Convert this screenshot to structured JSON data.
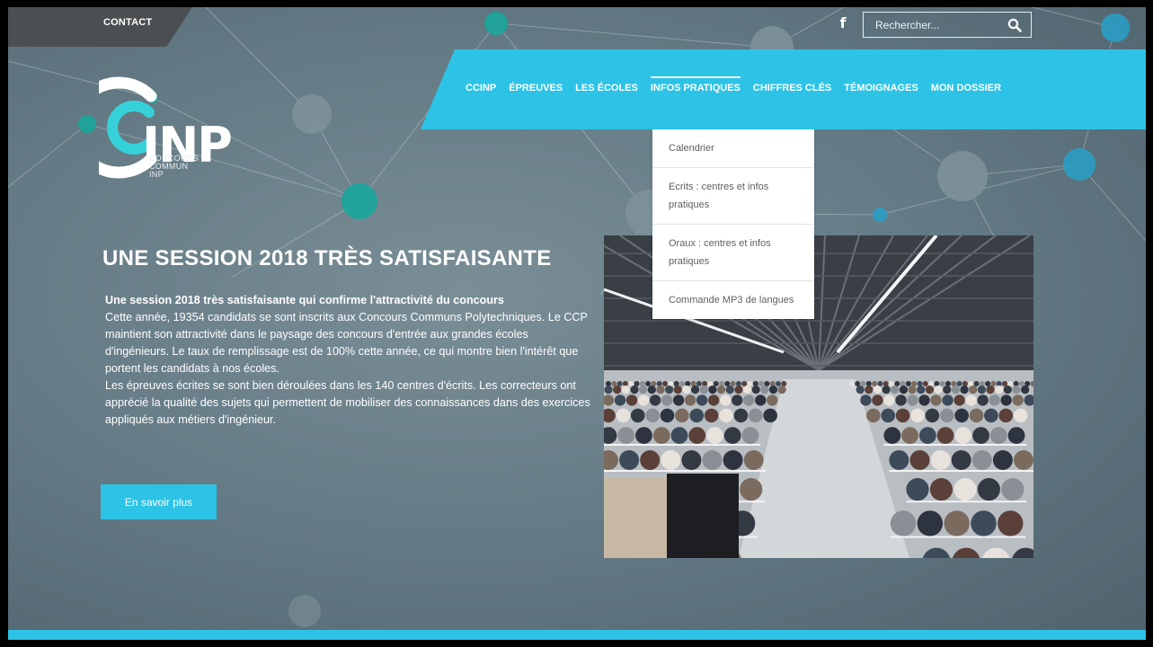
{
  "top_bar": {
    "contact_label": "CONTACT",
    "facebook_icon": "facebook-icon",
    "search_placeholder": "Rechercher...",
    "search_icon": "search-icon"
  },
  "logo": {
    "mark_text": "INP",
    "subtitle_lines": [
      "CONCOURS",
      "COMMUN",
      "INP"
    ]
  },
  "nav": {
    "items": [
      {
        "label": "CCINP",
        "active": false
      },
      {
        "label": "ÉPREUVES",
        "active": false
      },
      {
        "label": "LES ÉCOLES",
        "active": false
      },
      {
        "label": "INFOS PRATIQUES",
        "active": true
      },
      {
        "label": "CHIFFRES CLÉS",
        "active": false
      },
      {
        "label": "TÉMOIGNAGES",
        "active": false
      },
      {
        "label": "MON DOSSIER",
        "active": false
      }
    ]
  },
  "dropdown": {
    "items": [
      {
        "label": "Calendrier"
      },
      {
        "label": "Ecrits : centres et infos pratiques"
      },
      {
        "label": "Oraux : centres et infos pratiques"
      },
      {
        "label": "Commande MP3 de langues"
      }
    ]
  },
  "hero": {
    "title": "UNE SESSION 2018 TRÈS SATISFAISANTE",
    "lead": "Une session 2018 très satisfaisante qui confirme l'attractivité du concours",
    "paragraph_1": "Cette année, 19354 candidats se sont inscrits aux Concours Communs Polytechniques. Le CCP maintient son attractivité dans le paysage des concours d'entrée aux grandes écoles d'ingénieurs. Le taux de remplissage est de 100% cette année, ce qui montre bien l'intérêt que portent les candidats à nos écoles.",
    "paragraph_2": "Les épreuves écrites se sont bien déroulées dans les 140 centres d'écrits. Les correcteurs ont apprécié la qualité des sujets qui permettent de mobiliser des connaissances dans des exercices appliqués aux métiers d'ingénieur.",
    "button_label": "En savoir plus"
  },
  "colors": {
    "accent": "#2cc3e6",
    "node_teal": "#1aa69a",
    "node_blue": "#2a9dc4",
    "background": "#667c86"
  }
}
